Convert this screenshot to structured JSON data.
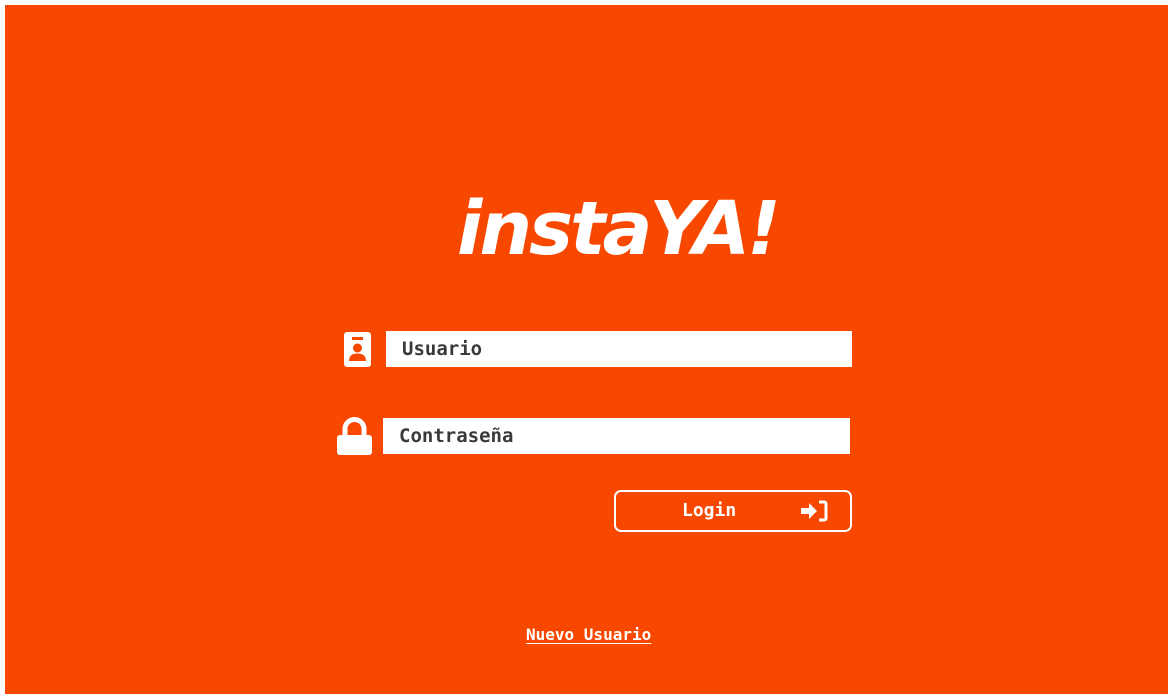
{
  "app": {
    "logo_text": "instaYA!"
  },
  "login_form": {
    "username_placeholder": "Usuario",
    "password_placeholder": "Contraseña",
    "username_icon": "id-badge-icon",
    "password_icon": "lock-icon",
    "login_label": "Login",
    "login_icon": "sign-in-icon"
  },
  "footer": {
    "new_user_link": "Nuevo Usuario"
  },
  "colors": {
    "background": "#f84800",
    "foreground": "#ffffff",
    "input_text": "#3a3a3a"
  }
}
